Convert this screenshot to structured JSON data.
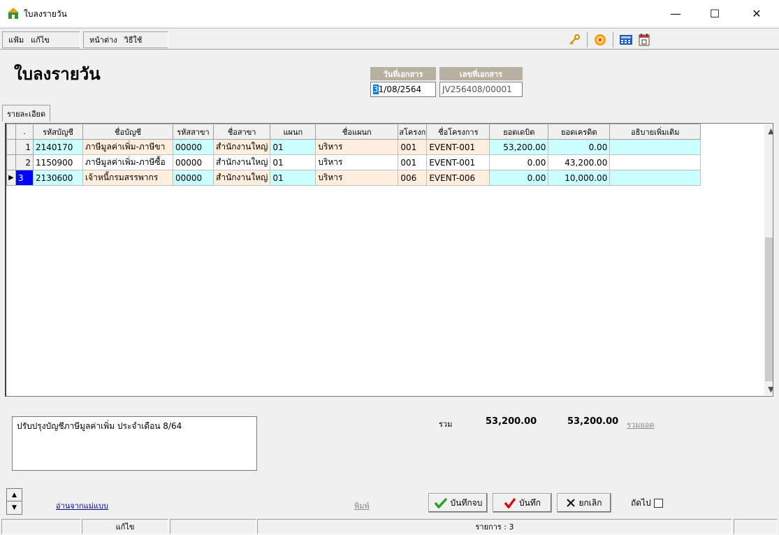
{
  "window": {
    "title": "ใบลงรายวัน",
    "minimize": "—",
    "maximize": "☐",
    "close": "✕"
  },
  "menu": {
    "file": "แฟ้ม",
    "edit": "แก้ไข",
    "window": "หน้าต่าง",
    "help": "วิธีใช้"
  },
  "toolbar": {
    "icons": [
      "key-icon",
      "help-disc-icon",
      "calculator-icon",
      "calendar-icon"
    ]
  },
  "header": {
    "title": "ใบลงรายวัน",
    "date_label": "วันที่เอกสาร",
    "date_value": "31/08/2564",
    "date_first_char": "3",
    "date_rest": "1/08/2564",
    "docno_label": "เลขที่เอกสาร",
    "docno_value": "JV256408/00001"
  },
  "tab": {
    "label": "รายละเอียด"
  },
  "grid": {
    "columns": [
      ".",
      "รหัสบัญชี",
      "ชื่อบัญชี",
      "รหัสสาขา",
      "ชื่อสาขา",
      "แผนก",
      "ชื่อแผนก",
      "สโครงก",
      "ชื่อโครงการ",
      "ยอดเดบิต",
      "ยอดเครดิต",
      "อธิบายเพิ่มเติม"
    ],
    "rows": [
      {
        "no": "1",
        "acct_code": "2140170",
        "acct_name": "ภาษีมูลค่าเพิ่ม-ภาษีขา",
        "branch_code": "00000",
        "branch_name": "สำนักงานใหญ่",
        "dept": "01",
        "dept_name": "บริหาร",
        "proj_code": "001",
        "proj_name": "EVENT-001",
        "debit": "53,200.00",
        "credit": "0.00",
        "note": ""
      },
      {
        "no": "2",
        "acct_code": "1150900",
        "acct_name": "ภาษีมูลค่าเพิ่ม-ภาษีซื้อ",
        "branch_code": "00000",
        "branch_name": "สำนักงานใหญ่",
        "dept": "01",
        "dept_name": "บริหาร",
        "proj_code": "001",
        "proj_name": "EVENT-001",
        "debit": "0.00",
        "credit": "43,200.00",
        "note": ""
      },
      {
        "no": "3",
        "acct_code": "2130600",
        "acct_name": "เจ้าหนี้กรมสรรพากร",
        "branch_code": "00000",
        "branch_name": "สำนักงานใหญ่",
        "dept": "01",
        "dept_name": "บริหาร",
        "proj_code": "006",
        "proj_name": "EVENT-006",
        "debit": "0.00",
        "credit": "10,000.00",
        "note": ""
      }
    ]
  },
  "footer": {
    "remark": "ปรับปรุงบัญชีภาษีมูลค่าเพิ่ม ประจำเดือน 8/64",
    "total_label": "รวม",
    "total_debit": "53,200.00",
    "total_credit": "53,200.00",
    "total_link": "รวมยอด",
    "template_link": "อ่านจากแม่แบบ",
    "print_link": "พิมพ์",
    "save_close": "บันทึกจบ",
    "save": "บันทึก",
    "cancel": "ยกเลิก",
    "next_label": "ถัดไป",
    "next_checked": false
  },
  "status": {
    "mode": "แก้ไข",
    "items": "รายการ : 3"
  },
  "colors": {
    "cyan_cell": "#ccffff",
    "peach_cell": "#ffeedd",
    "current_row": "#0000ff",
    "label_bg": "#b8b0a0"
  }
}
